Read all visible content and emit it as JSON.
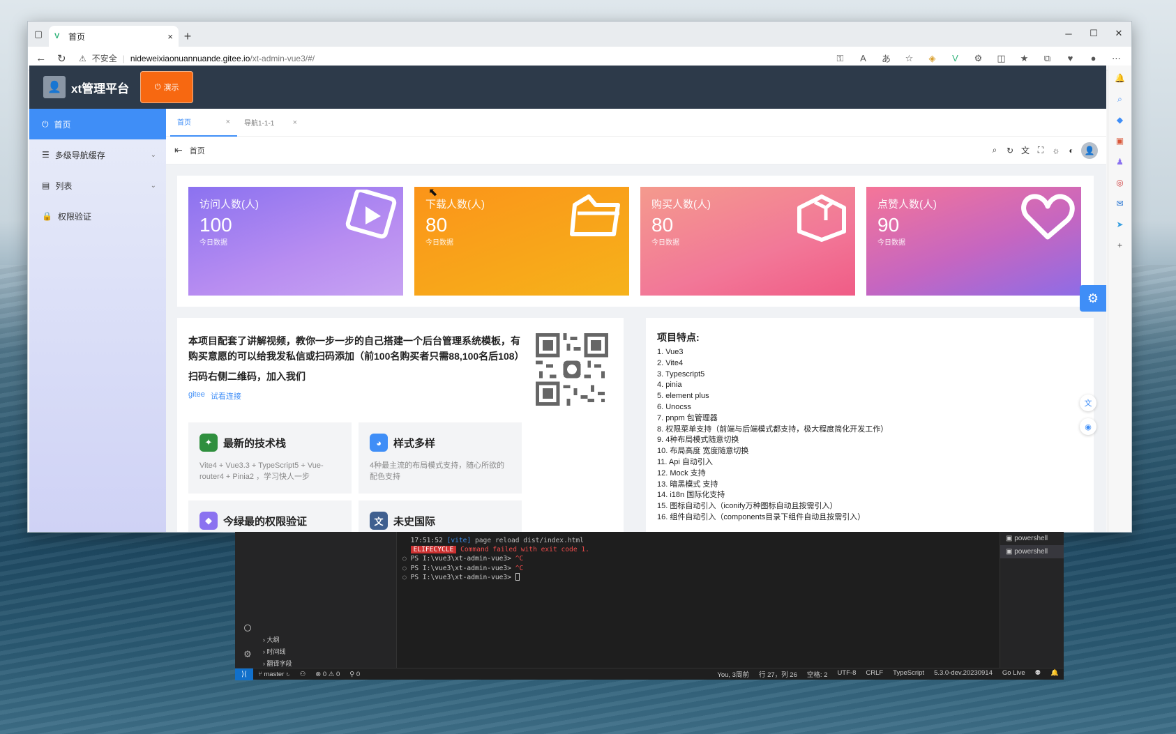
{
  "browser": {
    "tab_title": "首页",
    "url_warning": "不安全",
    "url_domain": "nideweixiaonuannuande.gitee.io",
    "url_path": "/xt-admin-vue3/#/"
  },
  "app": {
    "title": "xt管理平台",
    "demo_label": "演示",
    "menu": [
      {
        "label": "首页"
      },
      {
        "label": "多级导航缓存"
      },
      {
        "label": "列表"
      },
      {
        "label": "权限验证"
      }
    ],
    "tags": [
      {
        "label": "首页"
      },
      {
        "label": "导航1-1-1"
      }
    ],
    "breadcrumb": "首页",
    "stats": [
      {
        "label": "访问人数(人)",
        "value": "100",
        "sub": "今日数据",
        "icon": "play-icon"
      },
      {
        "label": "下载人数(人)",
        "value": "80",
        "sub": "今日数据",
        "icon": "folder-icon"
      },
      {
        "label": "购买人数(人)",
        "value": "80",
        "sub": "今日数据",
        "icon": "box-icon"
      },
      {
        "label": "点赞人数(人)",
        "value": "90",
        "sub": "今日数据",
        "icon": "heart-icon"
      }
    ],
    "intro": "本项目配套了讲解视频，教你一步一步的自己搭建一个后台管理系统模板，有购买意愿的可以给我发私信或扫码添加（前100名购买者只需88,100名后108）",
    "scan": "扫码右侧二维码，加入我们",
    "links": [
      "gitee",
      "试看连接"
    ],
    "features": [
      {
        "title": "最新的技术栈",
        "desc": "Vite4 + Vue3.3 + TypeScript5 + Vue-router4 + Pinia2 ，学习快人一步",
        "icon": "shield-icon",
        "color": "#2f8f3e"
      },
      {
        "title": "样式多样",
        "desc": "4种最主流的布局模式支持，随心所欲的配色支持",
        "icon": "palette-icon",
        "color": "#3f8ef7"
      },
      {
        "title": "今绿最的权限验证",
        "desc": "",
        "icon": "lock-icon",
        "color": "#8b72f0"
      },
      {
        "title": "未史国际",
        "desc": "",
        "icon": "globe-icon",
        "color": "#3f5f8f"
      }
    ],
    "project_title": "项目特点:",
    "project_items": [
      "1. Vue3",
      "2. Vite4",
      "3. Typescript5",
      "4. pinia",
      "5. element plus",
      "6. Unocss",
      "7. pnpm 包管理器",
      "8. 权限菜单支持（前端与后端模式都支持，极大程度简化开发工作）",
      "9. 4种布局模式随意切换",
      "10. 布局高度 宽度随意切换",
      "11. Api 自动引入",
      "12. Mock 支持",
      "13. 暗黑模式 支持",
      "14. i18n 国际化支持",
      "15. 图标自动引入（iconify万种图标自动且按需引入）",
      "16. 组件自动引入（components目录下组件自动且按需引入）"
    ]
  },
  "vscode": {
    "terminal": {
      "time": "17:51:52",
      "vite": "[vite]",
      "msg": "page reload dist/index.html",
      "err_tag": "ELIFECYCLE",
      "err_msg": "Command failed with exit code 1.",
      "prompt": "PS I:\\vue3\\xt-admin-vue3>",
      "ctrl_c": "^C"
    },
    "sidebar_sections": [
      "大纲",
      "时间线",
      "翻译字段"
    ],
    "terminals": [
      "powershell",
      "powershell"
    ],
    "status": {
      "branch": "master",
      "problems": "⊗ 0 ⚠ 0",
      "ports": "⚲ 0",
      "blame": "You, 3周前",
      "position": "行 27，列 26",
      "spaces": "空格: 2",
      "encoding": "UTF-8",
      "eol": "CRLF",
      "language": "TypeScript",
      "version": "5.3.0-dev.20230914",
      "golive": "Go Live"
    }
  }
}
